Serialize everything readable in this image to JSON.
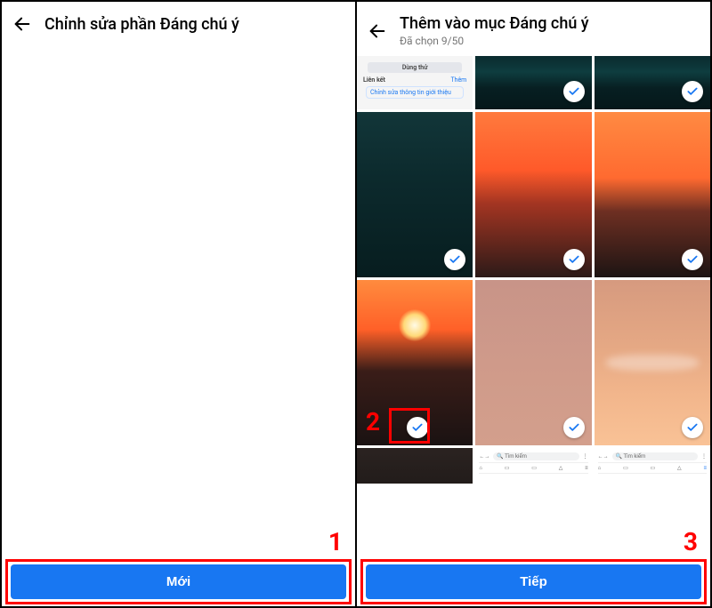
{
  "left": {
    "title": "Chỉnh sửa phần Đáng chú ý",
    "button": "Mới"
  },
  "right": {
    "title": "Thêm vào mục Đáng chú ý",
    "subtitle": "Đã chọn 9/50",
    "button": "Tiếp",
    "ui_card": {
      "try_btn": "Dùng thử",
      "link_label": "Liên kết",
      "link_action": "Thêm",
      "edit_intro": "Chỉnh sửa thông tin giới thiệu"
    },
    "browser_card": {
      "search_placeholder": "Tìm kiếm"
    }
  },
  "annotations": {
    "n1": "1",
    "n2": "2",
    "n3": "3"
  },
  "colors": {
    "primary": "#1877f2",
    "annot": "#ff0000"
  }
}
